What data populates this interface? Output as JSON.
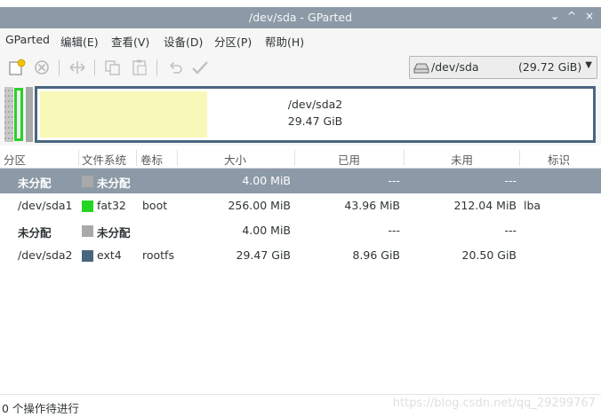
{
  "window": {
    "title": "/dev/sda - GParted",
    "controls": [
      "⌄",
      "^",
      "×"
    ]
  },
  "menu": [
    {
      "label": "GParted"
    },
    {
      "label": "编辑(E)"
    },
    {
      "label": "查看(V)"
    },
    {
      "label": "设备(D)"
    },
    {
      "label": "分区(P)"
    },
    {
      "label": "帮助(H)"
    }
  ],
  "toolbar": {
    "icons": [
      "new-partition-icon",
      "delete-icon",
      "resize-move-icon",
      "copy-icon",
      "paste-icon",
      "undo-icon",
      "apply-icon"
    ]
  },
  "device_selector": {
    "device": "/dev/sda",
    "size": "(29.72 GiB)",
    "icon": "disk-drive-icon"
  },
  "partition_graph": {
    "segments": [
      {
        "name": "/dev/sda1",
        "color": "#28d228"
      },
      {
        "name": "/dev/sda2",
        "size": "29.47 GiB",
        "color": "#4a6580",
        "used_color": "#f8f8b8",
        "used_fraction": 0.304
      }
    ]
  },
  "table": {
    "columns": [
      "分区",
      "文件系统",
      "卷标",
      "大小",
      "已用",
      "未用",
      "标识"
    ],
    "rows": [
      {
        "partition": "未分配",
        "fs": "未分配",
        "fs_color": "#a9a9a9",
        "label": "",
        "size": "4.00 MiB",
        "used": "---",
        "unused": "---",
        "flags": "",
        "selected": true,
        "bold": true
      },
      {
        "partition": "/dev/sda1",
        "fs": "fat32",
        "fs_color": "#22d622",
        "label": "boot",
        "size": "256.00 MiB",
        "used": "43.96 MiB",
        "unused": "212.04 MiB",
        "flags": "lba",
        "selected": false,
        "bold": false
      },
      {
        "partition": "未分配",
        "fs": "未分配",
        "fs_color": "#a9a9a9",
        "label": "",
        "size": "4.00 MiB",
        "used": "---",
        "unused": "---",
        "flags": "",
        "selected": false,
        "bold": true
      },
      {
        "partition": "/dev/sda2",
        "fs": "ext4",
        "fs_color": "#4a6580",
        "label": "rootfs",
        "size": "29.47 GiB",
        "used": "8.96 GiB",
        "unused": "20.50 GiB",
        "flags": "",
        "selected": false,
        "bold": false
      }
    ]
  },
  "status": {
    "text": "0 个操作待进行",
    "watermark": "https://blog.csdn.net/qq_29299767"
  }
}
